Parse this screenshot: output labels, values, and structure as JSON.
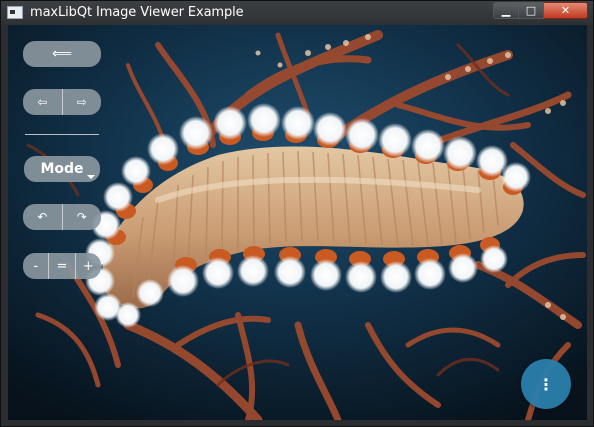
{
  "window": {
    "title": "maxLibQt Image Viewer Example",
    "controls": {
      "minimize": "▁",
      "maximize": "□",
      "close": "✕"
    }
  },
  "toolbar": {
    "back_icon": "⟸",
    "prev_icon": "⇦",
    "next_icon": "⇨",
    "mode_label": "Mode",
    "rotate_left_icon": "↶",
    "rotate_right_icon": "↷",
    "zoom_out_label": "-",
    "zoom_reset_label": "=",
    "zoom_in_label": "+"
  },
  "menu_button": {
    "icon": "⋮"
  },
  "colors": {
    "control_bg": "#89969e",
    "fab_bg": "#2a7eac",
    "title_bar": "#2e3134"
  }
}
